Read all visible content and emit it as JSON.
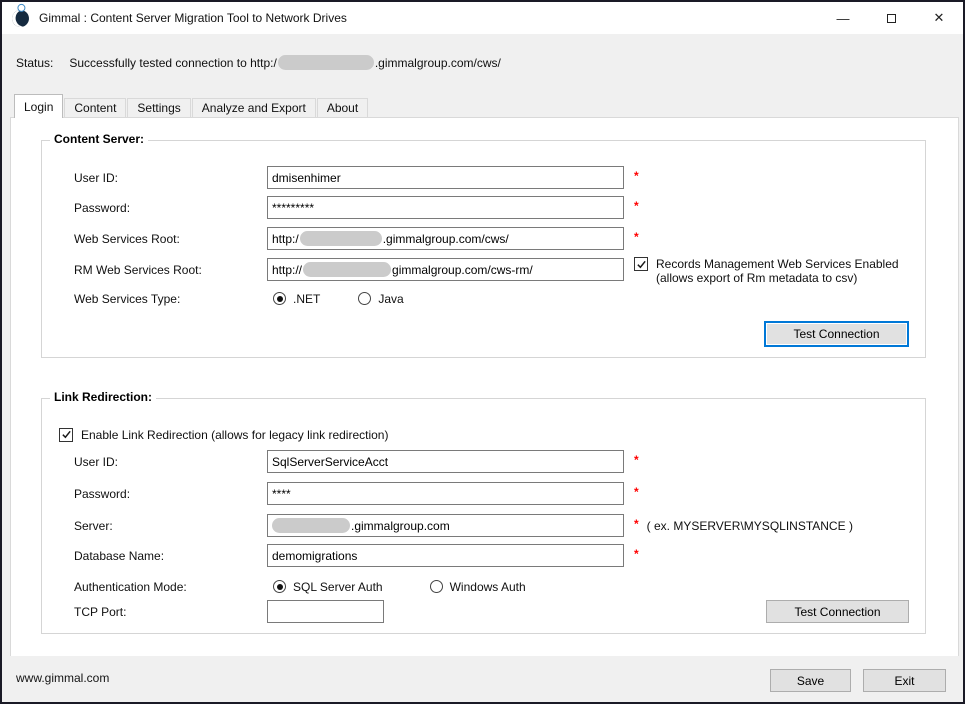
{
  "window": {
    "title": "Gimmal : Content Server Migration Tool to Network Drives",
    "minimize_glyph": "—",
    "close_glyph": "✕"
  },
  "status": {
    "label": "Status:",
    "before_redaction": "Successfully tested connection to http:/",
    "after_redaction": ".gimmalgroup.com/cws/"
  },
  "tabs": {
    "items": [
      {
        "label": "Login"
      },
      {
        "label": "Content"
      },
      {
        "label": "Settings"
      },
      {
        "label": "Analyze and Export"
      },
      {
        "label": "About"
      }
    ],
    "selected": "Login"
  },
  "content_server": {
    "title": "Content Server:",
    "required_marker": "*",
    "user_id": {
      "label": "User ID:",
      "value": "dmisenhimer"
    },
    "password": {
      "label": "Password:",
      "value": "*********"
    },
    "web_services_root": {
      "label": "Web Services Root:",
      "value_prefix": "http:/",
      "value_suffix": ".gimmalgroup.com/cws/"
    },
    "rm_web_services_root": {
      "label": "RM Web Services Root:",
      "value_prefix": "http://",
      "value_suffix": "gimmalgroup.com/cws-rm/"
    },
    "web_services_type": {
      "label": "Web Services Type:",
      "options": [
        ".NET",
        "Java"
      ],
      "selected": ".NET"
    },
    "rm_enabled_checkbox": {
      "line1": "Records Management Web Services Enabled",
      "line2": "(allows export of Rm metadata to csv)",
      "checked": true
    },
    "test_connection_label": "Test Connection"
  },
  "link_redirection": {
    "title": "Link Redirection:",
    "required_marker": "*",
    "enable_checkbox": {
      "label": "Enable Link Redirection (allows for legacy link redirection)",
      "checked": true
    },
    "user_id": {
      "label": "User ID:",
      "value": "SqlServerServiceAcct"
    },
    "password": {
      "label": "Password:",
      "value": "****"
    },
    "server": {
      "label": "Server:",
      "value_suffix": ".gimmalgroup.com",
      "hint": "( ex. MYSERVER\\MYSQLINSTANCE )"
    },
    "database_name": {
      "label": "Database Name:",
      "value": "demomigrations"
    },
    "authentication_mode": {
      "label": "Authentication Mode:",
      "options": [
        "SQL Server Auth",
        "Windows Auth"
      ],
      "selected": "SQL Server Auth"
    },
    "tcp_port": {
      "label": "TCP Port:",
      "value": ""
    },
    "test_connection_label": "Test Connection"
  },
  "footer": {
    "website": "www.gimmal.com",
    "save_label": "Save",
    "exit_label": "Exit"
  },
  "colors": {
    "focus_accent": "#0078d7",
    "required": "#ff0000"
  }
}
